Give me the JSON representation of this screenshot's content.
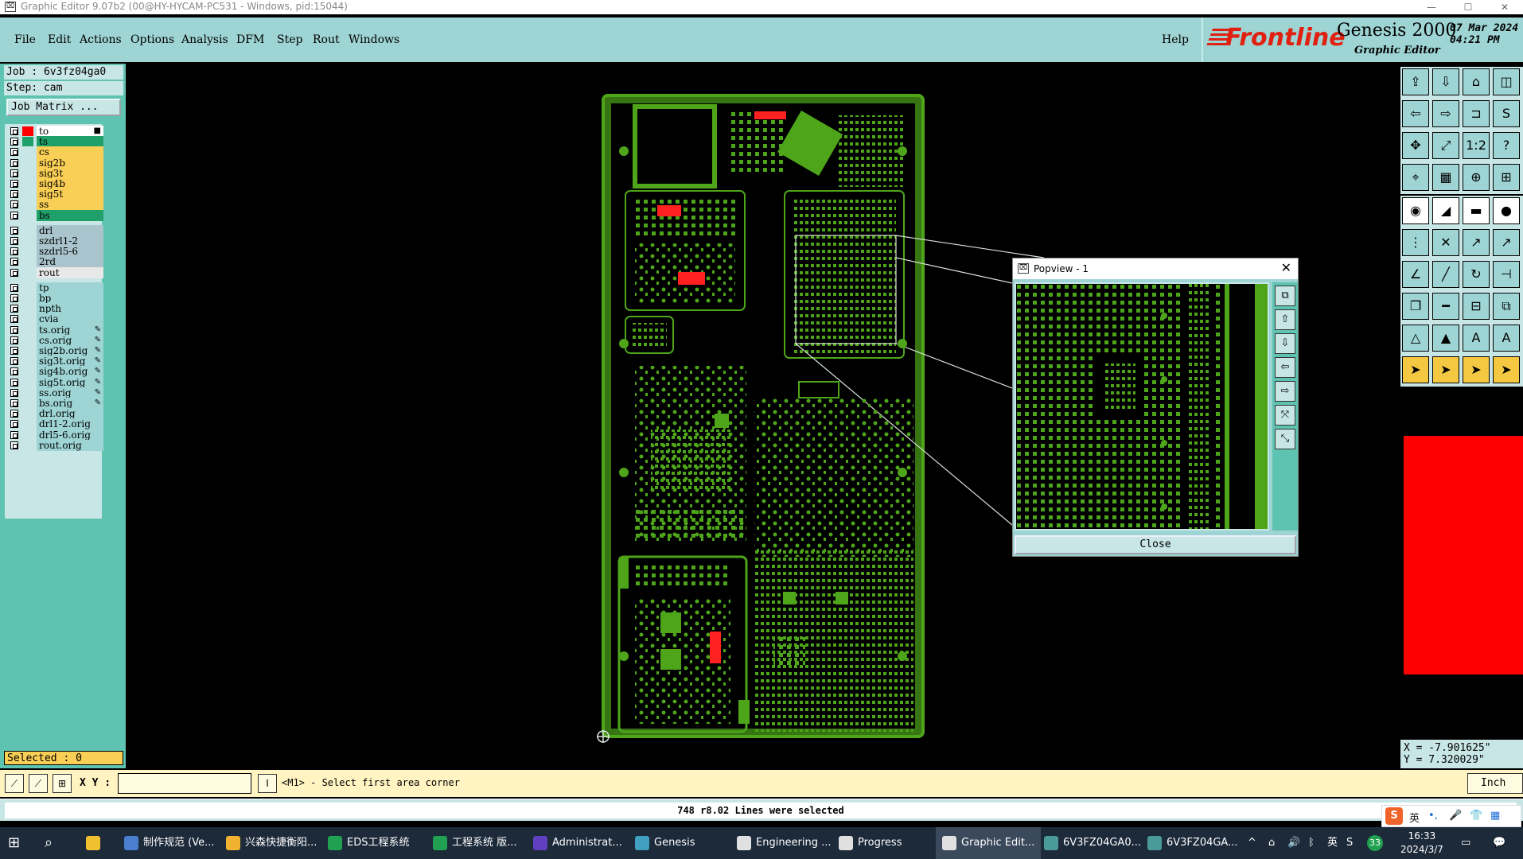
{
  "window": {
    "title": "Graphic Editor 9.07b2 (00@HY-HYCAM-PC531 - Windows, pid:15044)",
    "min": "—",
    "max": "☐",
    "close": "✕"
  },
  "menu": {
    "items": [
      "File",
      "Edit",
      "Actions",
      "Options",
      "Analysis",
      "DFM",
      "Step",
      "Rout",
      "Windows"
    ],
    "help": "Help"
  },
  "logo": {
    "brand": "Frontline",
    "product": "Genesis 2000",
    "subtitle": "Graphic Editor",
    "date": "07 Mar 2024",
    "time": "04:21 PM"
  },
  "job": {
    "job_line": "Job  : 6v3fz04ga0",
    "step_line": "Step: cam",
    "matrix_button": "Job Matrix ..."
  },
  "layers": [
    {
      "name": "to",
      "color": "#ffffff",
      "swatch": "#ff0000",
      "glyph": "■"
    },
    {
      "name": "ts",
      "color": "#1fa06a",
      "swatch": "#1fa06a",
      "glyph": ""
    },
    {
      "name": "cs",
      "color": "#f9cf55",
      "swatch": "",
      "glyph": ""
    },
    {
      "name": "sig2b",
      "color": "#f9cf55",
      "swatch": "",
      "glyph": ""
    },
    {
      "name": "sig3t",
      "color": "#f9cf55",
      "swatch": "",
      "glyph": ""
    },
    {
      "name": "sig4b",
      "color": "#f9cf55",
      "swatch": "",
      "glyph": ""
    },
    {
      "name": "sig5t",
      "color": "#f9cf55",
      "swatch": "",
      "glyph": ""
    },
    {
      "name": "ss",
      "color": "#f9cf55",
      "swatch": "",
      "glyph": ""
    },
    {
      "name": "bs",
      "color": "#1fa06a",
      "swatch": "",
      "glyph": ""
    },
    {
      "name": "drl",
      "color": "#a9c4cc",
      "swatch": "",
      "glyph": ""
    },
    {
      "name": "szdrl1-2",
      "color": "#a9c4cc",
      "swatch": "",
      "glyph": ""
    },
    {
      "name": "szdrl5-6",
      "color": "#a9c4cc",
      "swatch": "",
      "glyph": ""
    },
    {
      "name": "2rd",
      "color": "#a9c4cc",
      "swatch": "",
      "glyph": ""
    },
    {
      "name": "rout",
      "color": "#e8e8e8",
      "swatch": "",
      "glyph": ""
    },
    {
      "name": "tp",
      "color": "#9ed4d4",
      "swatch": "",
      "glyph": ""
    },
    {
      "name": "bp",
      "color": "#9ed4d4",
      "swatch": "",
      "glyph": ""
    },
    {
      "name": "npth",
      "color": "#9ed4d4",
      "swatch": "",
      "glyph": ""
    },
    {
      "name": "cvia",
      "color": "#9ed4d4",
      "swatch": "",
      "glyph": ""
    },
    {
      "name": "ts.orig",
      "color": "#9ed4d4",
      "swatch": "",
      "glyph": "✎"
    },
    {
      "name": "cs.orig",
      "color": "#9ed4d4",
      "swatch": "",
      "glyph": "✎"
    },
    {
      "name": "sig2b.orig",
      "color": "#9ed4d4",
      "swatch": "",
      "glyph": "✎"
    },
    {
      "name": "sig3t.orig",
      "color": "#9ed4d4",
      "swatch": "",
      "glyph": "✎"
    },
    {
      "name": "sig4b.orig",
      "color": "#9ed4d4",
      "swatch": "",
      "glyph": "✎"
    },
    {
      "name": "sig5t.orig",
      "color": "#9ed4d4",
      "swatch": "",
      "glyph": "✎"
    },
    {
      "name": "ss.orig",
      "color": "#9ed4d4",
      "swatch": "",
      "glyph": "✎"
    },
    {
      "name": "bs.orig",
      "color": "#9ed4d4",
      "swatch": "",
      "glyph": "✎"
    },
    {
      "name": "drl.orig",
      "color": "#9ed4d4",
      "swatch": "",
      "glyph": ""
    },
    {
      "name": "drl1-2.orig",
      "color": "#9ed4d4",
      "swatch": "",
      "glyph": ""
    },
    {
      "name": "drl5-6.orig",
      "color": "#9ed4d4",
      "swatch": "",
      "glyph": ""
    },
    {
      "name": "rout.orig",
      "color": "#9ed4d4",
      "swatch": "",
      "glyph": ""
    }
  ],
  "selected": "Selected : 0",
  "popview": {
    "title": "Popview - 1",
    "close_label": "Close"
  },
  "coords": {
    "x": "X = -7.901625\"",
    "y": "Y =  7.320029\""
  },
  "command": {
    "xy_label": "X Y :",
    "input_value": "",
    "prompt": "<M1> - Select first area corner",
    "units": "Inch"
  },
  "status": {
    "message": "748 r8.02 Lines were selected"
  },
  "taskbar": {
    "tasks": [
      {
        "label": "制作规范 (Ve...",
        "icon_color": "#4a7fd0"
      },
      {
        "label": "兴森快捷衡阳...",
        "icon_color": "#f0b030"
      },
      {
        "label": "EDS工程系统",
        "icon_color": "#20a050"
      },
      {
        "label": "工程系统   版...",
        "icon_color": "#20a050"
      },
      {
        "label": "Administrat...",
        "icon_color": "#6040c0"
      },
      {
        "label": "Genesis",
        "icon_color": "#40a0c0"
      },
      {
        "label": "Engineering ...",
        "icon_color": "#e0e0e0"
      },
      {
        "label": "Progress",
        "icon_color": "#e0e0e0"
      },
      {
        "label": "Graphic Edit...",
        "icon_color": "#e0e0e0"
      },
      {
        "label": "6V3FZ04GA0...",
        "icon_color": "#4a9a9a"
      },
      {
        "label": "6V3FZ04GA...",
        "icon_color": "#4a9a9a"
      }
    ],
    "time": "16:33",
    "date": "2024/3/7",
    "lang": "英",
    "badge": "33"
  },
  "ime": {
    "lang": "英"
  },
  "colors": {
    "pcb": "#4ea51a",
    "highlight": "#ff2020",
    "panel": "#9ed4d4"
  }
}
